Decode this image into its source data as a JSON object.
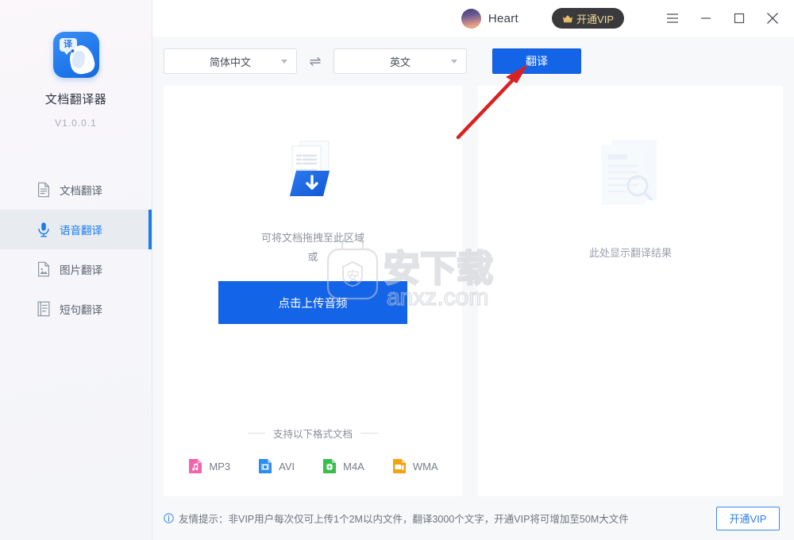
{
  "sidebar": {
    "logo_badge": "译",
    "app_title": "文档翻译器",
    "version": "V1.0.0.1",
    "items": [
      {
        "label": "文档翻译",
        "icon": "document-icon",
        "active": false
      },
      {
        "label": "语音翻译",
        "icon": "microphone-icon",
        "active": true
      },
      {
        "label": "图片翻译",
        "icon": "image-icon",
        "active": false
      },
      {
        "label": "短句翻译",
        "icon": "text-lines-icon",
        "active": false
      }
    ]
  },
  "titlebar": {
    "username": "Heart",
    "vip_label": "开通VIP",
    "menu_icon": "hamburger-icon",
    "minimize_icon": "minimize-icon",
    "maximize_icon": "maximize-icon",
    "close_icon": "close-icon"
  },
  "toolbar": {
    "source_lang": "简体中文",
    "swap_icon": "⇌",
    "target_lang": "英文",
    "translate_label": "翻译"
  },
  "upload": {
    "icon": "document-download-icon",
    "drop_hint_line1": "可将文档拖拽至此区域",
    "drop_hint_line2": "或",
    "button_label": "点击上传音频",
    "formats_title": "支持以下格式文档",
    "formats": [
      {
        "label": "MP3",
        "color": "#f265ad",
        "icon": "music-file-icon"
      },
      {
        "label": "AVI",
        "color": "#2d8cf0",
        "icon": "film-file-icon"
      },
      {
        "label": "M4A",
        "color": "#38bf4b",
        "icon": "disc-file-icon"
      },
      {
        "label": "WMA",
        "color": "#f3a312",
        "icon": "video-file-icon"
      }
    ]
  },
  "result": {
    "icon": "document-search-icon",
    "placeholder": "此处显示翻译结果"
  },
  "footer": {
    "info_icon": "info-icon",
    "tip": "友情提示：非VIP用户每次仅可上传1个2M以内文件，翻译3000个文字，开通VIP将可增加至50M大文件",
    "vip_label": "开通VIP"
  },
  "watermark": {
    "text_cn": "安下载",
    "text_en": "anxz.com"
  },
  "colors": {
    "accent_blue": "#1464e8",
    "sidebar_bg": "#f6f6fa",
    "panel_bg": "#ffffff",
    "content_bg": "#f7f8fa",
    "vip_dark": "#3a3a3c",
    "vip_gold": "#f2d79a",
    "annotation_red": "#d92121"
  }
}
